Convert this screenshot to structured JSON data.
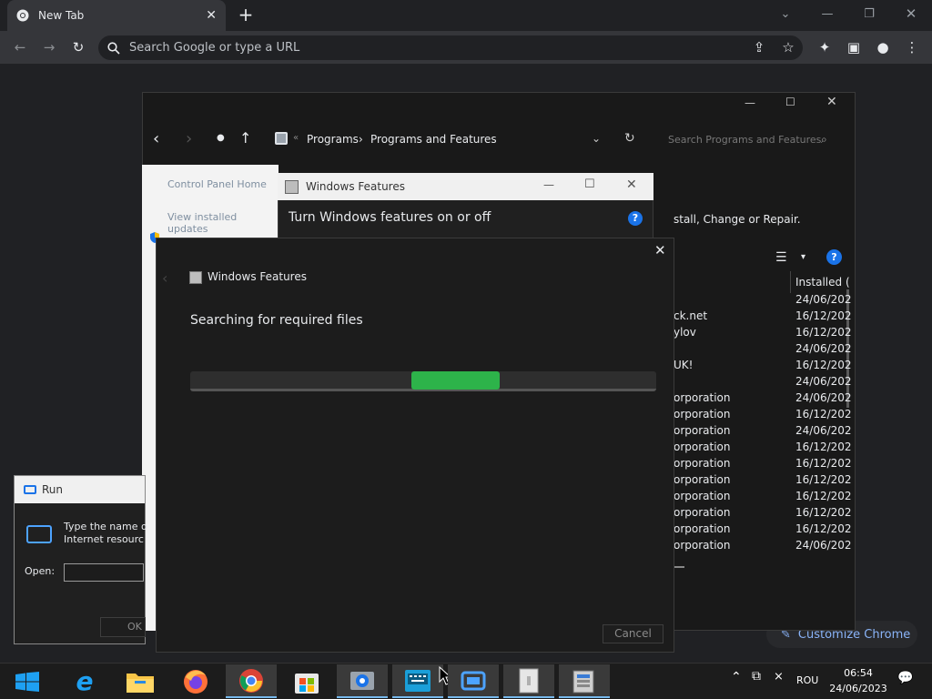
{
  "chrome": {
    "tab_title": "New Tab",
    "new_tab_symbol": "+",
    "omnibox_placeholder": "Search Google or type a URL",
    "customize_label": "Customize Chrome",
    "colors": {
      "tab": "#35363a",
      "background": "#202124"
    }
  },
  "control_panel": {
    "breadcrumb": [
      "Programs",
      "Programs and Features"
    ],
    "breadcrumb_sep": "›",
    "breadcrumb_prefix": "«",
    "search_placeholder": "Search Programs and Features",
    "sidebar": [
      "Control Panel Home",
      "View installed updates",
      "Turn Windows features on or off"
    ],
    "desc_text": "stall, Change or Repair.",
    "column_installed": "Installed (",
    "rows": [
      {
        "publisher": "",
        "date": "24/06/202"
      },
      {
        "publisher": "ck.net",
        "date": "16/12/202"
      },
      {
        "publisher": "ylov",
        "date": "16/12/202"
      },
      {
        "publisher": "",
        "date": "24/06/202"
      },
      {
        "publisher": "UK!",
        "date": "16/12/202"
      },
      {
        "publisher": "",
        "date": "24/06/202"
      },
      {
        "publisher": "orporation",
        "date": "24/06/202"
      },
      {
        "publisher": "orporation",
        "date": "16/12/202"
      },
      {
        "publisher": "orporation",
        "date": "24/06/202"
      },
      {
        "publisher": "orporation",
        "date": "16/12/202"
      },
      {
        "publisher": "orporation",
        "date": "16/12/202"
      },
      {
        "publisher": "orporation",
        "date": "16/12/202"
      },
      {
        "publisher": "orporation",
        "date": "16/12/202"
      },
      {
        "publisher": "orporation",
        "date": "16/12/202"
      },
      {
        "publisher": "orporation",
        "date": "16/12/202"
      },
      {
        "publisher": "orporation",
        "date": "24/06/202"
      }
    ]
  },
  "wf_dialog": {
    "title": "Windows Features",
    "heading": "Turn Windows features on or off"
  },
  "progress_dialog": {
    "title": "Windows Features",
    "status": "Searching for required files",
    "cancel_label": "Cancel",
    "accent": "#2db34a"
  },
  "run_dialog": {
    "title": "Run",
    "desc_line1": "Type the name o",
    "desc_line2": "Internet resourc",
    "open_label": "Open:",
    "ok_label": "OK"
  },
  "taskbar": {
    "language": "ROU",
    "time": "06:54",
    "date": "24/06/2023"
  }
}
